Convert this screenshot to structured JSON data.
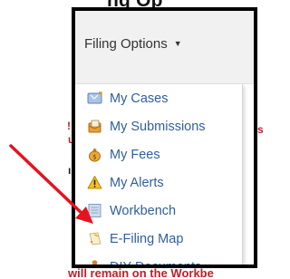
{
  "header": {
    "heading_fragment": "ng Op"
  },
  "background_fragments": {
    "red_1": "!",
    "red_2": "u",
    "dark_1": "ı",
    "red_3": "s",
    "bottom": "will remain on the Workbe"
  },
  "filing_options": {
    "label": "Filing Options",
    "caret": "▼"
  },
  "menu": {
    "items": [
      {
        "label": "My Cases",
        "icon": "cases-icon"
      },
      {
        "label": "My Submissions",
        "icon": "submissions-icon"
      },
      {
        "label": "My Fees",
        "icon": "fees-icon"
      },
      {
        "label": "My Alerts",
        "icon": "alert-icon"
      },
      {
        "label": "Workbench",
        "icon": "workbench-icon"
      },
      {
        "label": "E-Filing Map",
        "icon": "map-icon"
      },
      {
        "label": "DIY Documents",
        "icon": "diy-documents-icon"
      }
    ]
  },
  "colors": {
    "link": "#2f5f9c",
    "arrow": "#e3141f",
    "frame": "#000000",
    "bar_background": "#f1f1f1"
  }
}
